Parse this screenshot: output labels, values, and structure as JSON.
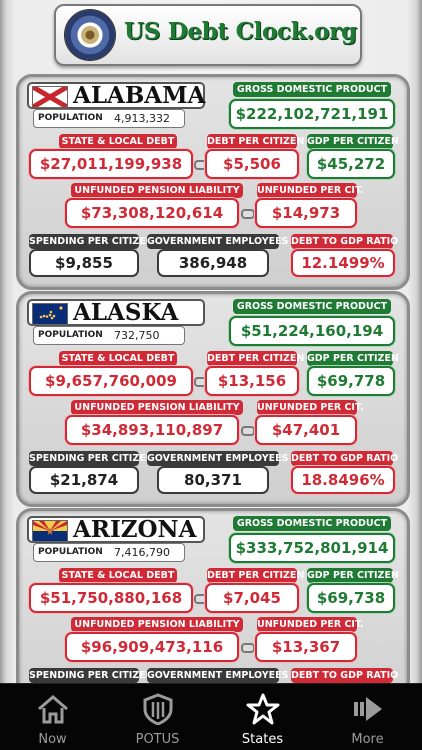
{
  "header": {
    "title": "US Debt Clock.org"
  },
  "labels": {
    "population": "POPULATION",
    "gdp": "GROSS DOMESTIC PRODUCT",
    "state_local_debt": "STATE & LOCAL DEBT",
    "debt_per_citizen": "DEBT PER CITIZEN",
    "gdp_per_citizen": "GDP PER CITIZEN",
    "unfunded_pension": "UNFUNDED PENSION LIABILITY",
    "unfunded_per_cit": "UNFUNDED PER CIT.",
    "spending_per_citizen": "SPENDING PER CITIZEN",
    "gov_employees": "GOVERNMENT EMPLOYEES",
    "debt_to_gdp": "DEBT TO GDP RATIO"
  },
  "states": [
    {
      "name": "ALABAMA",
      "flag": "alabama-flag-icon",
      "population": "4,913,332",
      "gdp": "$222,102,721,191",
      "state_local_debt": "$27,011,199,938",
      "debt_per_citizen": "$5,506",
      "gdp_per_citizen": "$45,272",
      "unfunded_pension": "$73,308,120,614",
      "unfunded_per_cit": "$14,973",
      "spending_per_citizen": "$9,855",
      "gov_employees": "386,948",
      "debt_to_gdp": "12.1499%"
    },
    {
      "name": "ALASKA",
      "flag": "alaska-flag-icon",
      "population": "732,750",
      "gdp": "$51,224,160,194",
      "state_local_debt": "$9,657,760,009",
      "debt_per_citizen": "$13,156",
      "gdp_per_citizen": "$69,778",
      "unfunded_pension": "$34,893,110,897",
      "unfunded_per_cit": "$47,401",
      "spending_per_citizen": "$21,874",
      "gov_employees": "80,371",
      "debt_to_gdp": "18.8496%"
    },
    {
      "name": "ARIZONA",
      "flag": "arizona-flag-icon",
      "population": "7,416,790",
      "gdp": "$333,752,801,914",
      "state_local_debt": "$51,750,880,168",
      "debt_per_citizen": "$7,045",
      "gdp_per_citizen": "$69,738",
      "unfunded_pension": "$96,909,473,116",
      "unfunded_per_cit": "$13,367",
      "spending_per_citizen": "",
      "gov_employees": "",
      "debt_to_gdp": ""
    }
  ],
  "tabs": [
    {
      "label": "Now",
      "icon": "home-icon"
    },
    {
      "label": "POTUS",
      "icon": "shield-icon"
    },
    {
      "label": "States",
      "icon": "star-icon",
      "active": true
    },
    {
      "label": "More",
      "icon": "arrow-right-icon"
    }
  ],
  "colors": {
    "red": "#cf2a36",
    "green": "#1f7a34",
    "dark": "#3a3a3a"
  }
}
